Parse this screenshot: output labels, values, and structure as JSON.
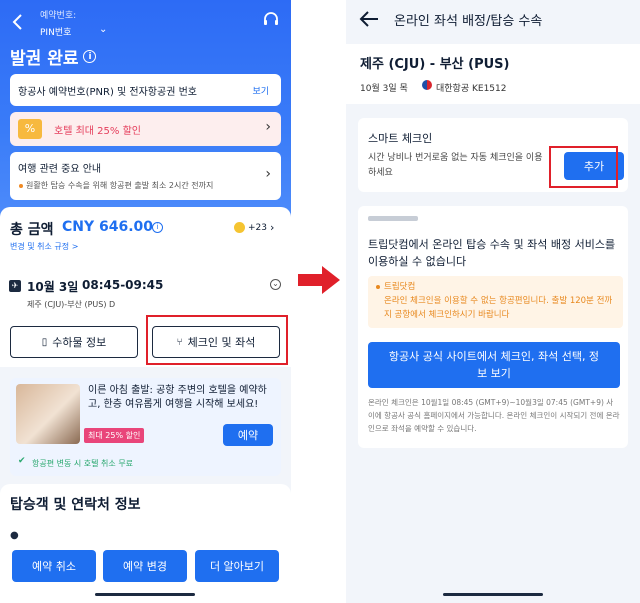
{
  "left": {
    "header": {
      "booking_no_label": "예약번호:",
      "pin_label": "PIN번호",
      "status_title": "발권 완료"
    },
    "pnr_card": {
      "label": "항공사 예약번호(PNR) 및 전자항공권 번호",
      "link": "보기"
    },
    "hotel_promo": {
      "text": "호텔 최대 25% 할인"
    },
    "notice": {
      "title": "여행 관련 중요 안내",
      "text": "원활한 탑승 수속을 위해 항공편 출발 최소 2시간 전까지"
    },
    "total": {
      "label": "총 금액",
      "amount": "CNY 646.00",
      "points": "+23",
      "policy_link": "변경 및 취소 규정 >"
    },
    "flight": {
      "date": "10월 3일",
      "time": "08:45-09:45",
      "route": "제주 (CJU)-부산 (PUS) D"
    },
    "buttons": {
      "baggage": "수하물 정보",
      "checkin": "체크인 및 좌석"
    },
    "hotel_offer": {
      "text": "이른 아침 출발: 공항 주변의 호텔을 예약하고, 한층 여유롭게 여행을 시작해 보세요!",
      "badge": "최대 25% 할인",
      "book": "예약",
      "free_cancel": "항공편 변동 시 호텔 취소 무료"
    },
    "passenger_section": "탑승객 및 연락처 정보",
    "bottom_buttons": {
      "cancel": "예약 취소",
      "change": "예약 변경",
      "more": "더 알아보기"
    }
  },
  "right": {
    "header_title": "온라인 좌석 배정/탑승 수속",
    "route": "제주 (CJU) - 부산 (PUS)",
    "flight_info": {
      "date": "10월 3일 목",
      "airline": "대한항공 KE1512"
    },
    "smart_checkin": {
      "title": "스마트 체크인",
      "desc": "시간 낭비나 번거로움 없는 자동 체크인을 이용하세요",
      "add": "추가"
    },
    "unavailable": {
      "title": "트립닷컴에서 온라인 탑승 수속 및 좌석 배정 서비스를 이용하실 수 없습니다",
      "warning": "온라인 체크인을 이용할 수 없는 항공편입니다. 출발 120분 전까지 공항에서 체크인하시기 바랍니다",
      "warning_prefix": "트립닷컴",
      "action": "항공사 공식 사이트에서 체크인, 좌석 선택, 정보 보기",
      "footnote": "온라인 체크인은 10월1일 08:45 (GMT+9)~10월3일 07:45 (GMT+9) 사이에 항공사 공식 홈페이지에서 가능합니다. 온라인 체크인이 시작되기 전에 온라인으로 좌석을 예약할 수 있습니다."
    }
  },
  "colors": {
    "accent": "#1f6ff0",
    "highlight_box": "#e0202a",
    "arrow": "#e0202a"
  }
}
